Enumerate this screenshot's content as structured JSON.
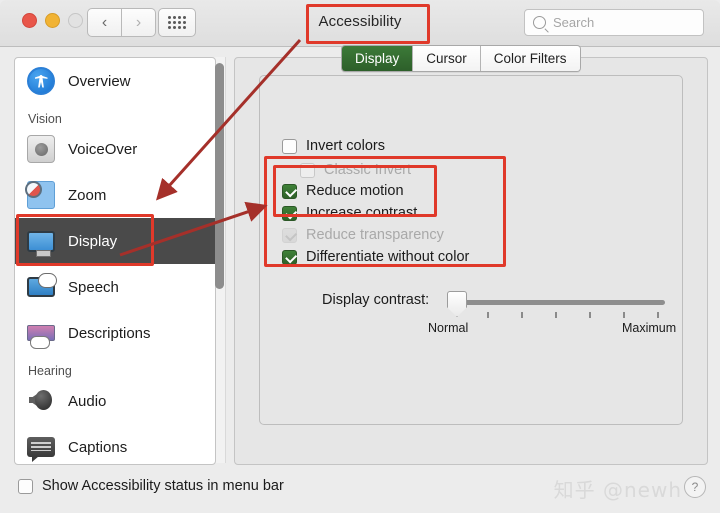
{
  "window": {
    "title": "Accessibility",
    "traffic_lights": [
      "close-red",
      "minimize-yellow",
      "zoom-green-disabled"
    ],
    "nav_back": "‹",
    "nav_forward": "›",
    "grid_icon": "grid-icon"
  },
  "search": {
    "placeholder": "Search",
    "value": "",
    "icon": "search-icon"
  },
  "sidebar": {
    "items": [
      {
        "label": "Overview",
        "icon": "accessibility-person-icon",
        "type": "item",
        "selected": false
      },
      {
        "label": "Vision",
        "type": "group"
      },
      {
        "label": "VoiceOver",
        "icon": "voiceover-icon",
        "type": "item",
        "selected": false
      },
      {
        "label": "Zoom",
        "icon": "zoom-magnifier-icon",
        "type": "item",
        "selected": false
      },
      {
        "label": "Display",
        "icon": "display-monitor-icon",
        "type": "item",
        "selected": true
      },
      {
        "label": "Speech",
        "icon": "speech-bubble-icon",
        "type": "item",
        "selected": false
      },
      {
        "label": "Descriptions",
        "icon": "descriptions-icon",
        "type": "item",
        "selected": false
      },
      {
        "label": "Hearing",
        "type": "group"
      },
      {
        "label": "Audio",
        "icon": "speaker-icon",
        "type": "item",
        "selected": false
      },
      {
        "label": "Captions",
        "icon": "captions-icon",
        "type": "item",
        "selected": false
      }
    ]
  },
  "main": {
    "tabs": [
      {
        "label": "Display",
        "active": true
      },
      {
        "label": "Cursor",
        "active": false
      },
      {
        "label": "Color Filters",
        "active": false
      }
    ],
    "checkboxes": [
      {
        "label": "Invert colors",
        "checked": false,
        "disabled": false,
        "indent": 0
      },
      {
        "label": "Classic Invert",
        "checked": false,
        "disabled": true,
        "indent": 1
      },
      {
        "label": "Reduce motion",
        "checked": true,
        "disabled": false,
        "indent": 0
      },
      {
        "label": "Increase contrast",
        "checked": true,
        "disabled": false,
        "indent": 0
      },
      {
        "label": "Reduce transparency",
        "checked": true,
        "disabled": true,
        "indent": 0
      },
      {
        "label": "Differentiate without color",
        "checked": true,
        "disabled": false,
        "indent": 0
      }
    ],
    "slider": {
      "label": "Display contrast:",
      "min_label": "Normal",
      "max_label": "Maximum",
      "value": 0,
      "ticks": 6
    }
  },
  "footer": {
    "checkbox_label": "Show Accessibility status in menu bar",
    "checkbox_checked": false,
    "help_label": "?",
    "watermark": "知乎 @newh"
  },
  "colors": {
    "accent_green": "#356b31",
    "annotation_red": "#e0392a",
    "selected_row": "#4a4a4a",
    "window_bg": "#ececec",
    "panel_bg": "#e6e6e6"
  }
}
